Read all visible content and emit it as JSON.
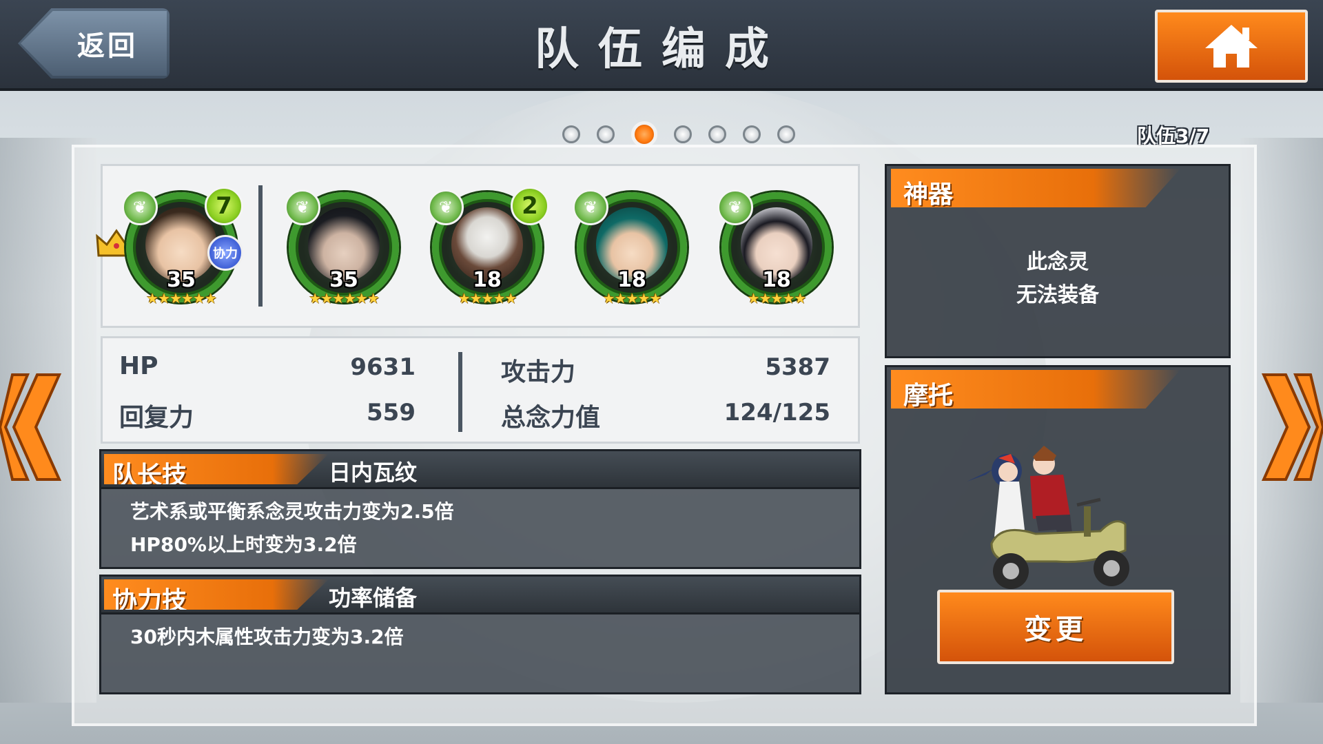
{
  "header": {
    "back_label": "返回",
    "title": "队伍编成"
  },
  "pager": {
    "pages": 7,
    "active_index": 2,
    "party_count": "队伍3/7"
  },
  "members": [
    {
      "level": "35",
      "stars": "★★★★★★",
      "badge": "7",
      "assist_label": "协力",
      "leader": true
    },
    {
      "level": "35",
      "stars": "★★★★★★"
    },
    {
      "level": "18",
      "stars": "★★★★★",
      "badge": "2"
    },
    {
      "level": "18",
      "stars": "★★★★★"
    },
    {
      "level": "18",
      "stars": "★★★★★"
    }
  ],
  "stats": {
    "hp_label": "HP",
    "hp_value": "9631",
    "recovery_label": "回复力",
    "recovery_value": "559",
    "attack_label": "攻击力",
    "attack_value": "5387",
    "total_label": "总念力值",
    "total_value": "124/125"
  },
  "leader_skill": {
    "tag": "队长技",
    "name": "日内瓦纹",
    "desc_line1": "艺术系或平衡系念灵攻击力变为2.5倍",
    "desc_line2": "HP80%以上时变为3.2倍"
  },
  "assist_skill": {
    "tag": "协力技",
    "name": "功率储备",
    "desc_line1": "30秒内木属性攻击力变为3.2倍"
  },
  "artifact": {
    "tag": "神器",
    "line1": "此念灵",
    "line2": "无法装备"
  },
  "motorbike": {
    "tag": "摩托",
    "change_label": "变更"
  },
  "colors": {
    "accent": "#ff8a1c",
    "header": "#2b323c",
    "panel": "#2f363e",
    "element_ring": "#3e9a2e"
  }
}
